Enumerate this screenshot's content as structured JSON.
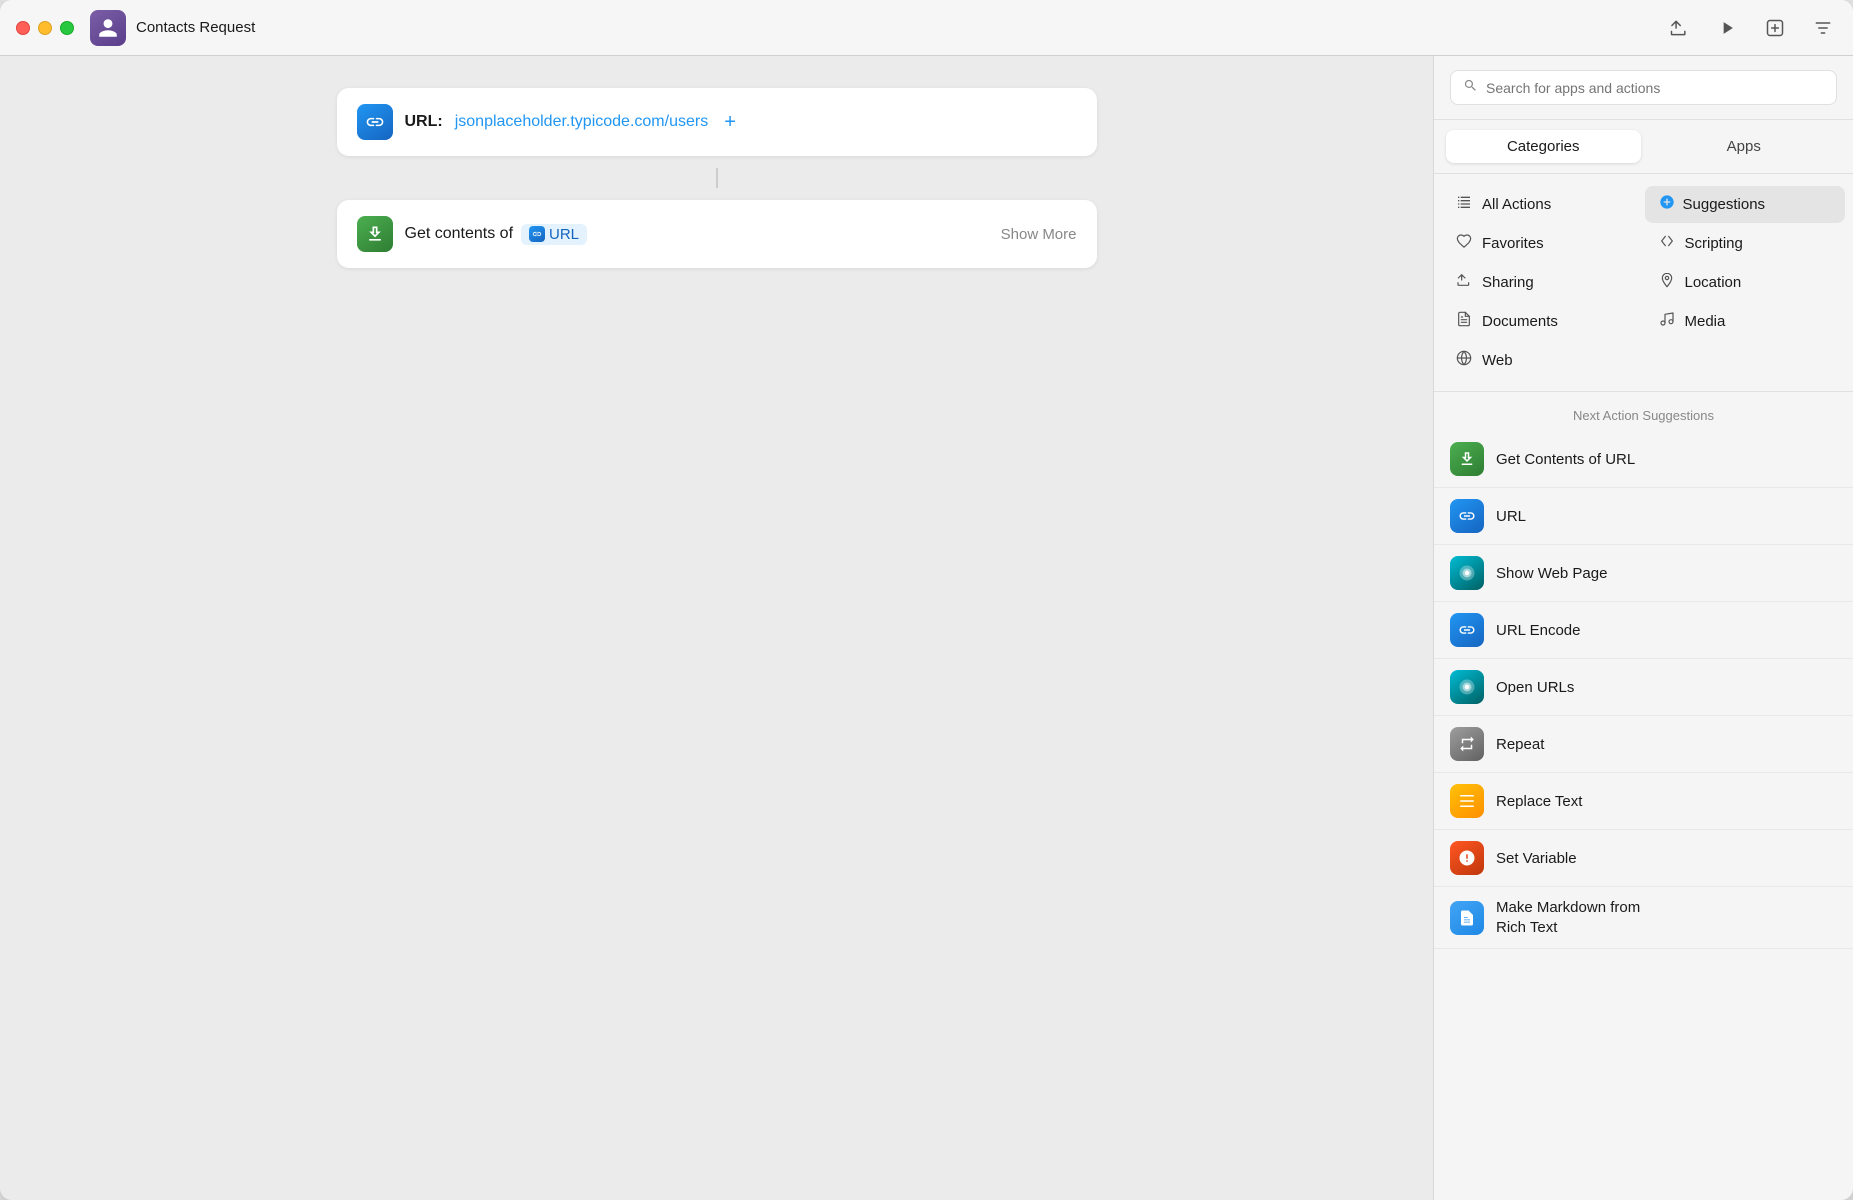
{
  "window": {
    "title": "Contacts Request",
    "app_icon": "👤"
  },
  "toolbar": {
    "share_label": "Share",
    "run_label": "Run",
    "new_action_label": "New Action",
    "filter_label": "Filter"
  },
  "workflow": {
    "url_card": {
      "label": "URL:",
      "value": "jsonplaceholder.typicode.com/users",
      "add_label": "+"
    },
    "action_card": {
      "text_before": "Get contents of",
      "chip_label": "URL",
      "show_more": "Show More"
    }
  },
  "right_panel": {
    "search": {
      "placeholder": "Search for apps and actions"
    },
    "tabs": [
      {
        "label": "Categories",
        "active": true
      },
      {
        "label": "Apps",
        "active": false
      }
    ],
    "categories_left": [
      {
        "label": "All Actions",
        "icon": "≡",
        "active": false
      },
      {
        "label": "Favorites",
        "icon": "♡"
      },
      {
        "label": "Sharing",
        "icon": "⬆"
      },
      {
        "label": "Documents",
        "icon": "📄"
      },
      {
        "label": "Web",
        "icon": "◎"
      }
    ],
    "categories_right": [
      {
        "label": "Suggestions",
        "icon": "+",
        "active": true
      },
      {
        "label": "Scripting",
        "icon": "◈"
      },
      {
        "label": "Location",
        "icon": "➤"
      },
      {
        "label": "Media",
        "icon": "♪"
      }
    ],
    "suggestions_header": "Next Action Suggestions",
    "suggestions": [
      {
        "label": "Get Contents of URL",
        "icon_class": "green",
        "icon": "⬇"
      },
      {
        "label": "URL",
        "icon_class": "blue",
        "icon": "🔗"
      },
      {
        "label": "Show Web Page",
        "icon_class": "teal",
        "icon": "◉"
      },
      {
        "label": "URL Encode",
        "icon_class": "blue",
        "icon": "🔗"
      },
      {
        "label": "Open URLs",
        "icon_class": "teal",
        "icon": "◉"
      },
      {
        "label": "Repeat",
        "icon_class": "gray",
        "icon": "⟳"
      },
      {
        "label": "Replace Text",
        "icon_class": "yellow",
        "icon": "≡"
      },
      {
        "label": "Set Variable",
        "icon_class": "red-orange",
        "icon": "①"
      },
      {
        "label": "Make Markdown from Rich Text",
        "icon_class": "doc-blue",
        "icon": "📋",
        "multiline": true
      }
    ]
  }
}
